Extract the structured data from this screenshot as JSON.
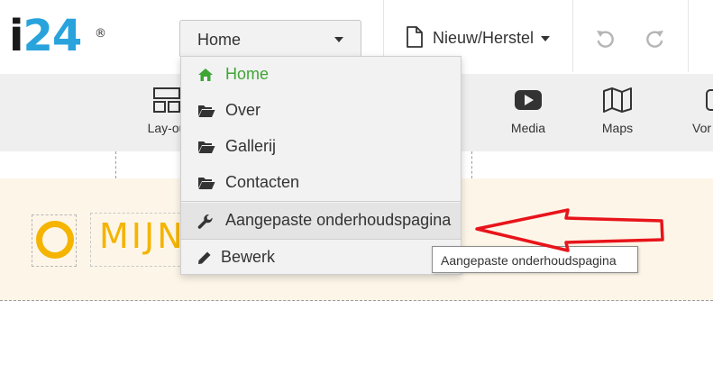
{
  "brand": {
    "logo_i": "i",
    "logo_num": "24",
    "registered": "®"
  },
  "page_select": {
    "value": "Home"
  },
  "new_restore": {
    "label": "Nieuw/Herstel"
  },
  "toolbar": {
    "layout": "Lay-ou",
    "media": "Media",
    "maps": "Maps",
    "forms": "Vor"
  },
  "site": {
    "title": "MIJN B"
  },
  "menu": {
    "items": [
      {
        "label": "Home",
        "icon": "home-icon",
        "active": true
      },
      {
        "label": "Over",
        "icon": "folder-open-icon"
      },
      {
        "label": "Gallerij",
        "icon": "folder-open-icon"
      },
      {
        "label": "Contacten",
        "icon": "folder-open-icon"
      },
      {
        "label": "Aangepaste onderhoudspagina",
        "icon": "wrench-icon"
      },
      {
        "label": "Bewerk",
        "icon": "pencil-icon"
      }
    ]
  },
  "tooltip": {
    "text": "Aangepaste onderhoudspagina"
  },
  "colors": {
    "accent_blue": "#29a3dc",
    "active_green": "#3fa535",
    "brand_yellow": "#f4b400",
    "annotation_red": "#e8141b"
  }
}
